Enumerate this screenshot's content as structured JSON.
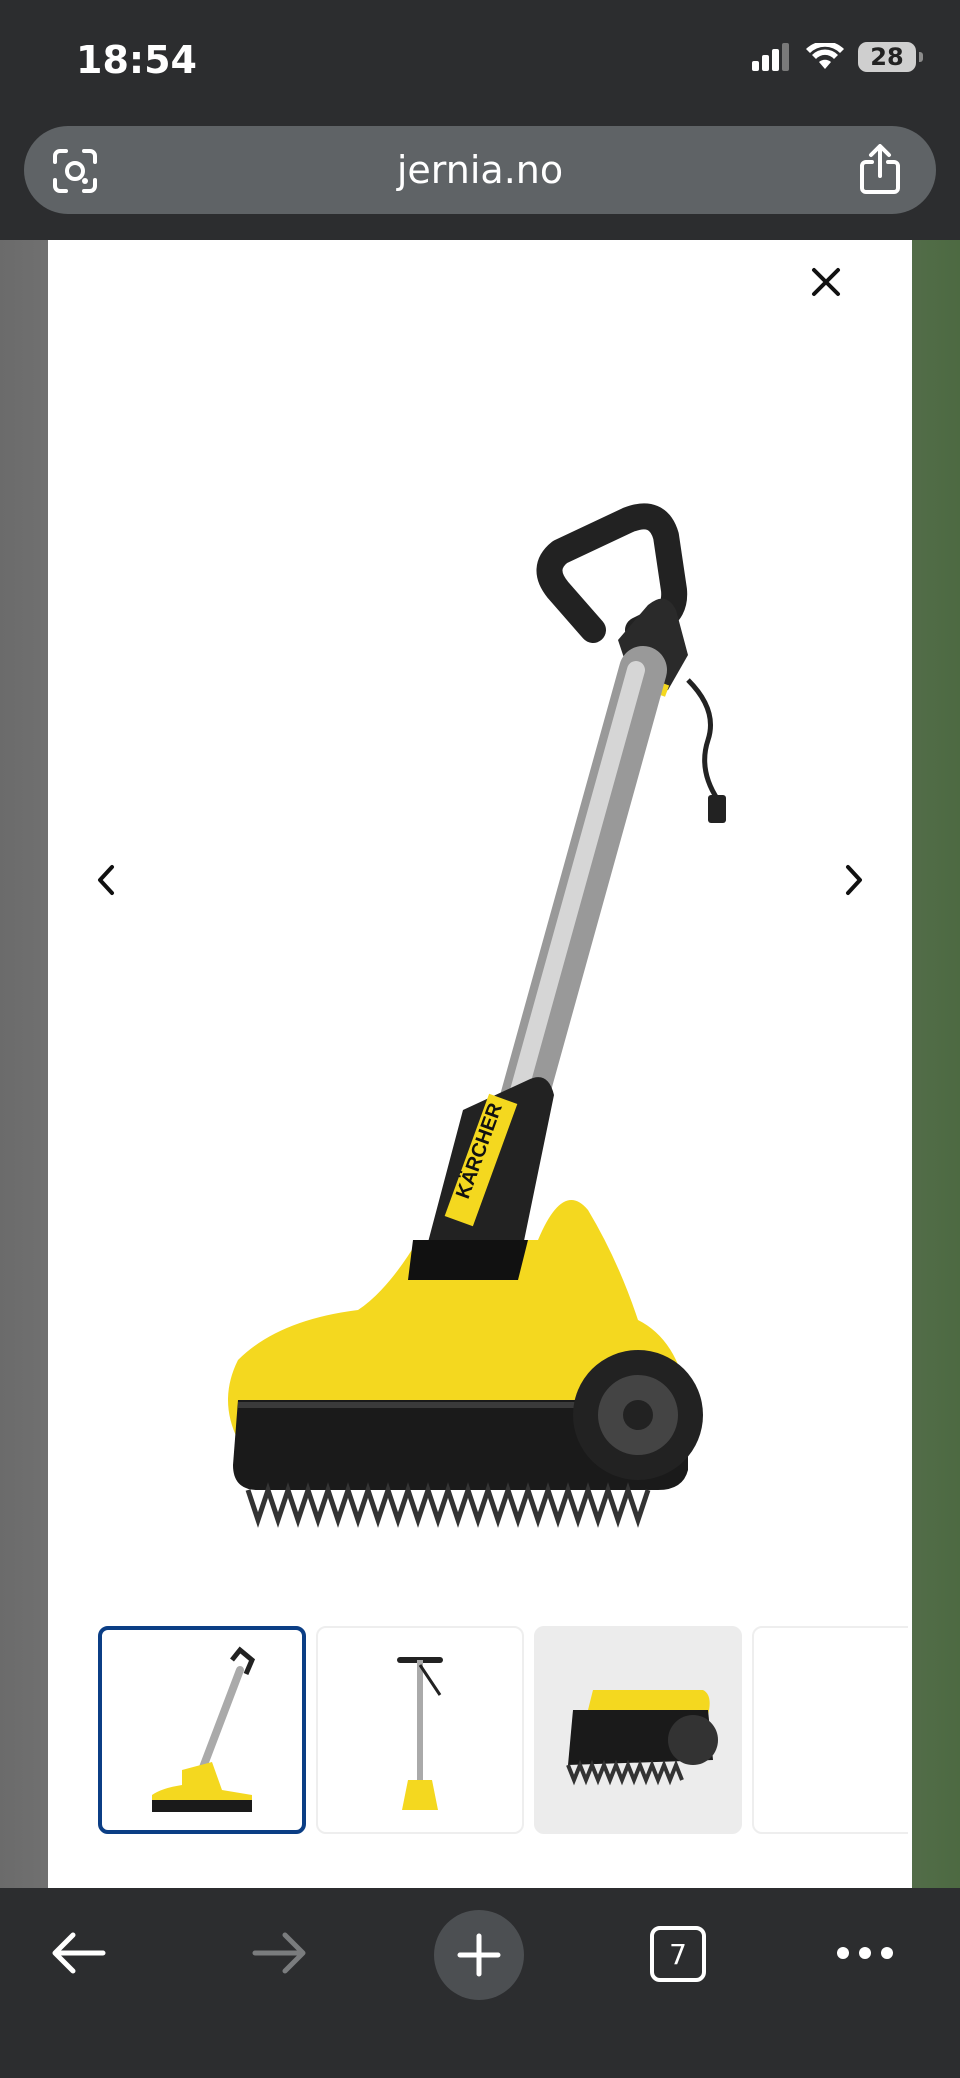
{
  "status_bar": {
    "time": "18:54",
    "battery": "28"
  },
  "browser": {
    "url": "jernia.no",
    "tabs_count": "7"
  },
  "gallery": {
    "product_brand_label": "KÄRCHER",
    "thumbnails": [
      {
        "label": "thumbnail-1",
        "selected": true
      },
      {
        "label": "thumbnail-2",
        "selected": false
      },
      {
        "label": "thumbnail-3",
        "selected": false
      },
      {
        "label": "thumbnail-4",
        "selected": false
      }
    ]
  },
  "colors": {
    "accent": "#0b3e85",
    "brand_yellow": "#f4d81f",
    "dark": "#2c2d2f"
  }
}
